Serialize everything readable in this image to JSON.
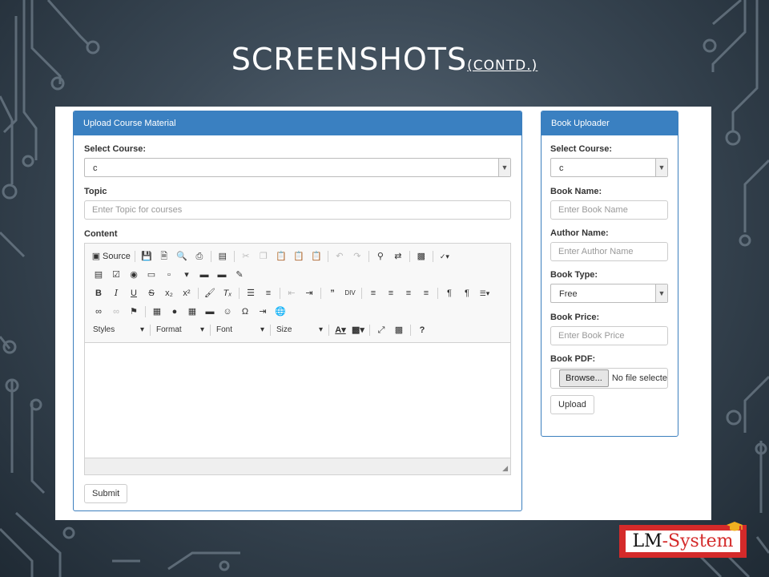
{
  "slide": {
    "title": "SCREENSHOTS",
    "subtitle": "(CONTD.)"
  },
  "upload_panel": {
    "heading": "Upload Course Material",
    "select_course_label": "Select Course:",
    "select_course_value": "c",
    "topic_label": "Topic",
    "topic_placeholder": "Enter Topic for courses",
    "content_label": "Content",
    "submit_label": "Submit"
  },
  "editor_toolbar": {
    "source_label": "Source",
    "combos": [
      "Styles",
      "Format",
      "Font",
      "Size"
    ],
    "rows": [
      [
        "new-doc-icon",
        "save-icon",
        "preview-icon",
        "print-icon",
        "templates-icon",
        "cut-icon",
        "copy-icon",
        "paste-icon",
        "paste-text-icon",
        "paste-word-icon",
        "undo-icon",
        "redo-icon",
        "find-icon",
        "replace-icon",
        "select-all-icon",
        "spellcheck-icon"
      ],
      [
        "form-icon",
        "checkbox-icon",
        "radio-icon",
        "text-field-icon",
        "textarea-icon",
        "select-field-icon",
        "button-icon",
        "image-button-icon",
        "hidden-field-icon"
      ],
      [
        "bold-icon",
        "italic-icon",
        "underline-icon",
        "strike-icon",
        "subscript-icon",
        "superscript-icon",
        "copy-format-icon",
        "remove-format-icon",
        "numbered-list-icon",
        "bulleted-list-icon",
        "outdent-icon",
        "indent-icon",
        "blockquote-icon",
        "div-icon",
        "align-left-icon",
        "align-center-icon",
        "align-right-icon",
        "justify-icon",
        "ltr-icon",
        "rtl-icon",
        "language-icon"
      ],
      [
        "link-icon",
        "unlink-icon",
        "anchor-icon",
        "image-icon",
        "flash-icon",
        "table-icon",
        "horizontal-line-icon",
        "smiley-icon",
        "special-char-icon",
        "page-break-icon",
        "iframe-icon"
      ],
      [
        "text-color-icon",
        "background-color-icon",
        "maximize-icon",
        "show-blocks-icon",
        "help-icon"
      ]
    ]
  },
  "book_panel": {
    "heading": "Book Uploader",
    "select_course_label": "Select Course:",
    "select_course_value": "c",
    "book_name_label": "Book Name:",
    "book_name_placeholder": "Enter Book Name",
    "author_name_label": "Author Name:",
    "author_name_placeholder": "Enter Author Name",
    "book_type_label": "Book Type:",
    "book_type_value": "Free",
    "book_price_label": "Book Price:",
    "book_price_placeholder": "Enter Book Price",
    "book_pdf_label": "Book PDF:",
    "browse_label": "Browse...",
    "no_file_label": "No file selected.",
    "upload_label": "Upload"
  },
  "logo": {
    "text_lm": "LM",
    "text_dash": "-",
    "text_system": "System",
    "colors": {
      "badge": "#d42a2a",
      "cap": "#f0b020"
    }
  },
  "colors": {
    "panel_heading": "#3a80c1",
    "panel_border": "#3c7fbe",
    "background": "#3c4a57"
  }
}
